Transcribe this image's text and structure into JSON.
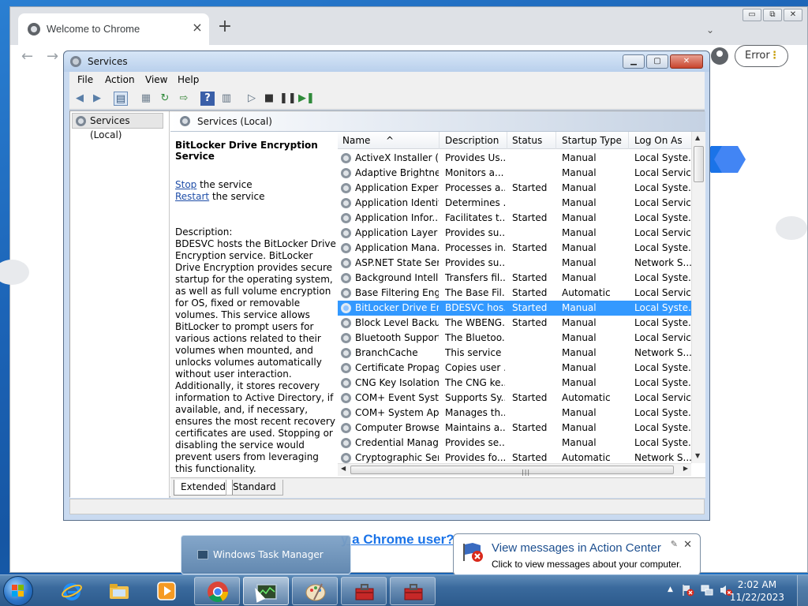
{
  "chrome": {
    "tab_title": "Welcome to Chrome",
    "tab_close": "×",
    "new_tab": "+",
    "back": "←",
    "forward": "→",
    "dropdown": "⌄",
    "minimize": "▭",
    "restore": "⧉",
    "close": "✕",
    "error_label": "Error",
    "menu_dots": "⋮",
    "page_link": "y a Chrome user?"
  },
  "services": {
    "title": "Services",
    "caption": {
      "min": "▁",
      "max": "▢",
      "close": "✕"
    },
    "menu": [
      "File",
      "Action",
      "View",
      "Help"
    ],
    "tree_root": "Services (Local)",
    "pane_title": "Services (Local)",
    "selected_service": "BitLocker Drive Encryption Service",
    "stop_link": "Stop",
    "stop_suffix": " the service",
    "restart_link": "Restart",
    "restart_suffix": " the service",
    "description_label": "Description:",
    "description": "BDESVC hosts the BitLocker Drive Encryption service. BitLocker Drive Encryption provides secure startup for the operating system, as well as full volume encryption for OS, fixed or removable volumes. This service allows BitLocker to prompt users for various actions related to their volumes when mounted, and unlocks volumes automatically without user interaction. Additionally, it stores recovery information to Active Directory, if available, and, if necessary, ensures the most recent recovery certificates are used. Stopping or disabling the service would prevent users from leveraging this functionality.",
    "columns": [
      "Name",
      "Description",
      "Status",
      "Startup Type",
      "Log On As"
    ],
    "rows": [
      [
        "ActiveX Installer (...",
        "Provides Us...",
        "",
        "Manual",
        "Local Syste..."
      ],
      [
        "Adaptive Brightness",
        "Monitors a...",
        "",
        "Manual",
        "Local Service"
      ],
      [
        "Application Experi...",
        "Processes a...",
        "Started",
        "Manual",
        "Local Syste..."
      ],
      [
        "Application Identity",
        "Determines ...",
        "",
        "Manual",
        "Local Service"
      ],
      [
        "Application Infor...",
        "Facilitates t...",
        "Started",
        "Manual",
        "Local Syste..."
      ],
      [
        "Application Layer ...",
        "Provides su...",
        "",
        "Manual",
        "Local Service"
      ],
      [
        "Application Mana...",
        "Processes in...",
        "Started",
        "Manual",
        "Local Syste..."
      ],
      [
        "ASP.NET State Ser...",
        "Provides su...",
        "",
        "Manual",
        "Network S..."
      ],
      [
        "Background Intelli...",
        "Transfers fil...",
        "Started",
        "Manual",
        "Local Syste..."
      ],
      [
        "Base Filtering Engi...",
        "The Base Fil...",
        "Started",
        "Automatic",
        "Local Service"
      ],
      [
        "BitLocker Drive En...",
        "BDESVC hos...",
        "Started",
        "Manual",
        "Local Syste..."
      ],
      [
        "Block Level Backu...",
        "The WBENG...",
        "Started",
        "Manual",
        "Local Syste..."
      ],
      [
        "Bluetooth Support...",
        "The Bluetoo...",
        "",
        "Manual",
        "Local Service"
      ],
      [
        "BranchCache",
        "This service ...",
        "",
        "Manual",
        "Network S..."
      ],
      [
        "Certificate Propag...",
        "Copies user ...",
        "",
        "Manual",
        "Local Syste..."
      ],
      [
        "CNG Key Isolation",
        "The CNG ke...",
        "",
        "Manual",
        "Local Syste..."
      ],
      [
        "COM+ Event Syst...",
        "Supports Sy...",
        "Started",
        "Automatic",
        "Local Service"
      ],
      [
        "COM+ System Ap...",
        "Manages th...",
        "",
        "Manual",
        "Local Syste..."
      ],
      [
        "Computer Browser",
        "Maintains a...",
        "Started",
        "Manual",
        "Local Syste..."
      ],
      [
        "Credential Manager",
        "Provides se...",
        "",
        "Manual",
        "Local Syste..."
      ],
      [
        "Cryptographic Ser...",
        "Provides fo...",
        "Started",
        "Automatic",
        "Network S..."
      ]
    ],
    "selected_row_index": 10,
    "tabs": [
      "Extended",
      "Standard"
    ]
  },
  "taskbar": {
    "popup_title": "Windows Task Manager",
    "time": "2:02 AM",
    "date": "11/22/2023"
  },
  "balloon": {
    "title": "View messages in Action Center",
    "message": "Click to view messages about your computer.",
    "close": "✕",
    "pin": "✎"
  },
  "colors": {
    "selection": "#3399ff",
    "link": "#1f4ea8",
    "chrome_blue": "#1a73e8"
  }
}
